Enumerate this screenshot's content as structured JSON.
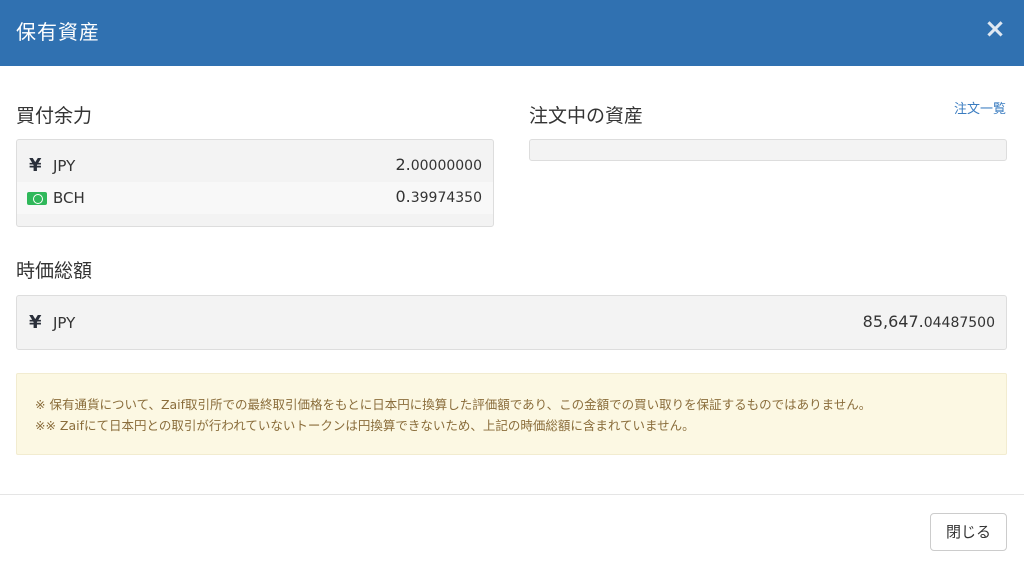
{
  "modal": {
    "title": "保有資産",
    "close_symbol": "×",
    "close_label": "閉じる"
  },
  "buying_power": {
    "title": "買付余力",
    "rows": [
      {
        "icon": "yen-icon",
        "currency": "JPY",
        "amount_int": "2.",
        "amount_dec": "00000000"
      },
      {
        "icon": "bch-icon",
        "currency": "BCH",
        "amount_int": "0.",
        "amount_dec": "39974350"
      }
    ]
  },
  "orders": {
    "title": "注文中の資産",
    "link": "注文一覧"
  },
  "market_value": {
    "title": "時価総額",
    "rows": [
      {
        "icon": "yen-icon",
        "currency": "JPY",
        "amount_int": "85,647.",
        "amount_dec": "04487500"
      }
    ]
  },
  "notice": {
    "line1": "※ 保有通貨について、Zaif取引所での最終取引価格をもとに日本円に換算した評価額であり、この金額での買い取りを保証するものではありません。",
    "line2": "※※ Zaifにて日本円との取引が行われていないトークンは円換算できないため、上記の時価総額に含まれていません。"
  },
  "icons": {
    "yen_glyph": "¥"
  },
  "colors": {
    "header": "#3071b1",
    "notice_bg": "#fcf8e3",
    "notice_text": "#8a6d3b",
    "bch_green": "#2fb85a",
    "link": "#3a7cc0"
  }
}
